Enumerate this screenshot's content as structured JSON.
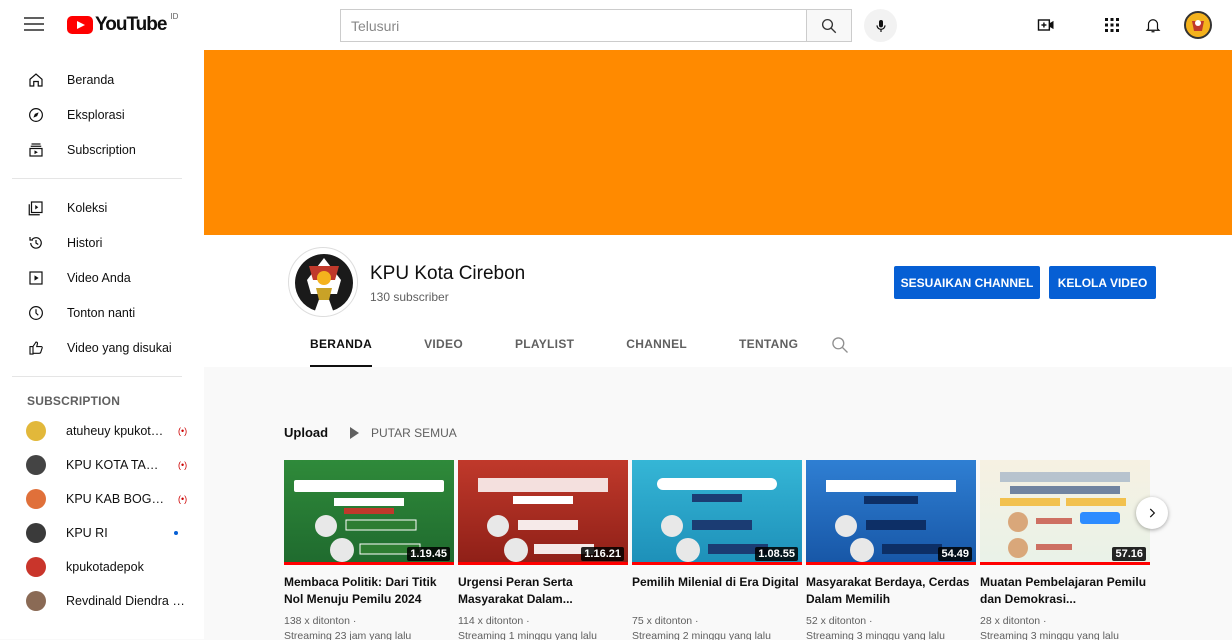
{
  "header": {
    "logo_text": "YouTube",
    "country_code": "ID",
    "search_placeholder": "Telusuri"
  },
  "sidebar": {
    "main_items": [
      {
        "label": "Beranda",
        "icon": "home-icon"
      },
      {
        "label": "Eksplorasi",
        "icon": "compass-icon"
      },
      {
        "label": "Subscription",
        "icon": "subscriptions-icon"
      }
    ],
    "library_items": [
      {
        "label": "Koleksi",
        "icon": "library-icon"
      },
      {
        "label": "Histori",
        "icon": "history-icon"
      },
      {
        "label": "Video Anda",
        "icon": "your-videos-icon"
      },
      {
        "label": "Tonton nanti",
        "icon": "clock-icon"
      },
      {
        "label": "Video yang disukai",
        "icon": "thumbs-up-icon"
      }
    ],
    "subscription_heading": "SUBSCRIPTION",
    "subscriptions": [
      {
        "name": "atuheuy kpukotab...",
        "status": "live",
        "color": "#e2b83a"
      },
      {
        "name": "KPU KOTA TASIK...",
        "status": "live",
        "color": "#444444"
      },
      {
        "name": "KPU KAB BOGOR",
        "status": "live",
        "color": "#e0703a"
      },
      {
        "name": "KPU RI",
        "status": "new",
        "color": "#3a3a3a"
      },
      {
        "name": "kpukotadepok",
        "status": "",
        "color": "#c9352b"
      },
      {
        "name": "Revdinald Diendra Gi...",
        "status": "",
        "color": "#8a6a55"
      }
    ]
  },
  "channel": {
    "name": "KPU Kota Cirebon",
    "subscribers": "130 subscriber",
    "customize_label": "SESUAIKAN CHANNEL",
    "manage_label": "KELOLA VIDEO",
    "tabs": [
      "BERANDA",
      "VIDEO",
      "PLAYLIST",
      "CHANNEL",
      "TENTANG"
    ],
    "active_tab": "BERANDA",
    "banner_color": "#ff8a00"
  },
  "uploads": {
    "title": "Upload",
    "play_all": "PUTAR SEMUA",
    "videos": [
      {
        "title": "Membaca Politik: Dari Titik Nol Menuju Pemilu 2024",
        "duration": "1.19.45",
        "views": "138 x ditonton ·",
        "time": "Streaming 23 jam yang lalu",
        "theme": "green"
      },
      {
        "title": "Urgensi Peran Serta Masyarakat Dalam...",
        "duration": "1.16.21",
        "views": "114 x ditonton ·",
        "time": "Streaming 1 minggu yang lalu",
        "theme": "red"
      },
      {
        "title": "Pemilih Milenial di Era Digital",
        "duration": "1.08.55",
        "views": "75 x ditonton ·",
        "time": "Streaming 2 minggu yang lalu",
        "theme": "cyan"
      },
      {
        "title": "Masyarakat Berdaya, Cerdas Dalam Memilih",
        "duration": "54.49",
        "views": "52 x ditonton ·",
        "time": "Streaming 3 minggu yang lalu",
        "theme": "blue"
      },
      {
        "title": "Muatan Pembelajaran Pemilu dan Demokrasi...",
        "duration": "57.16",
        "views": "28 x ditonton ·",
        "time": "Streaming 3 minggu yang lalu",
        "theme": "light"
      }
    ]
  }
}
